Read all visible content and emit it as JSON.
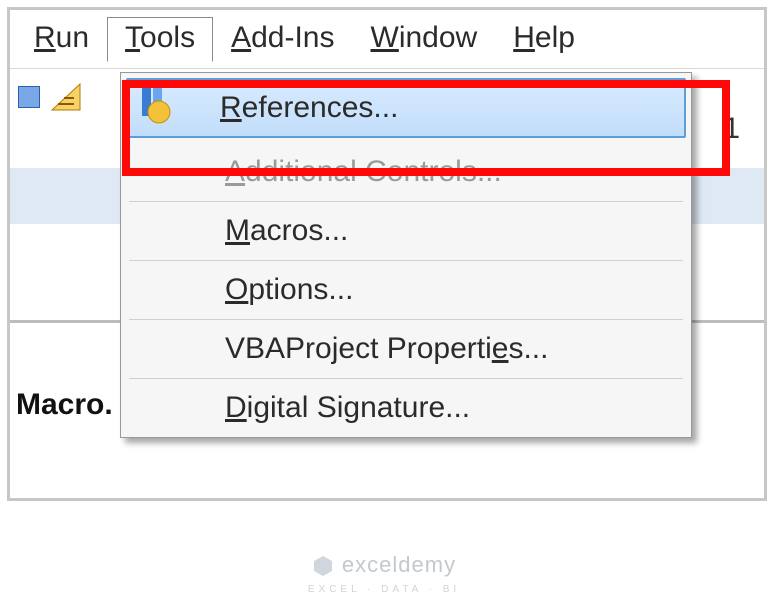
{
  "menubar": {
    "items": [
      {
        "pre": "R",
        "rest": "un"
      },
      {
        "pre": "T",
        "rest": "ools"
      },
      {
        "pre": "A",
        "rest": "dd-Ins"
      },
      {
        "pre": "W",
        "rest": "indow"
      },
      {
        "pre": "H",
        "rest": "elp"
      }
    ],
    "open_index": 1
  },
  "toolbar_trailing_text": "1",
  "left_text": "Macro.",
  "dropdown": {
    "items": [
      {
        "raw": "References...",
        "pre": "R",
        "rest": "eferences...",
        "state": "highlight",
        "has_icon": true
      },
      {
        "raw": "Additional Controls...",
        "pre": "A",
        "rest": "dditional Controls...",
        "state": "disabled"
      },
      {
        "raw": "Macros...",
        "pre": "M",
        "rest": "acros...",
        "state": "normal"
      },
      {
        "raw": "Options...",
        "pre": "O",
        "rest": "ptions...",
        "state": "normal"
      },
      {
        "raw": "VBAProject Properties...",
        "pre": "",
        "rest": "VBAProject Properti",
        "ul": "e",
        "tail": "s...",
        "state": "normal"
      },
      {
        "raw": "Digital Signature...",
        "pre": "D",
        "rest": "igital Signature...",
        "state": "normal"
      }
    ]
  },
  "watermark": {
    "brand": "exceldemy",
    "tagline": "EXCEL · DATA · BI"
  }
}
